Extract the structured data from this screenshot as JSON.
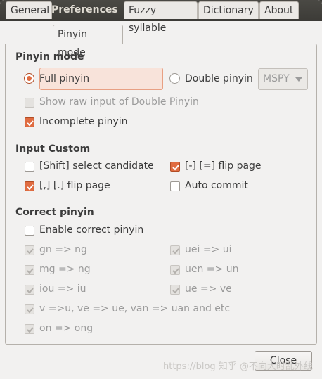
{
  "window": {
    "title": "Preferences"
  },
  "tabs": [
    {
      "label": "General"
    },
    {
      "label": "Pinyin mode"
    },
    {
      "label": "Fuzzy syllable"
    },
    {
      "label": "Dictionary"
    },
    {
      "label": "About"
    }
  ],
  "active_tab": "Pinyin mode",
  "pinyin_mode": {
    "heading": "Pinyin mode",
    "full_pinyin": {
      "label": "Full pinyin",
      "selected": true
    },
    "double_pinyin": {
      "label": "Double pinyin",
      "selected": false
    },
    "scheme": {
      "value": "MSPY"
    },
    "show_raw": {
      "label": "Show raw input of Double Pinyin",
      "checked": false,
      "enabled": false
    },
    "incomplete": {
      "label": "Incomplete pinyin",
      "checked": true
    }
  },
  "input_custom": {
    "heading": "Input Custom",
    "shift_select": {
      "label": "[Shift] select candidate",
      "checked": false
    },
    "minus_equal_flip": {
      "label": "[-] [=] flip page",
      "checked": true
    },
    "comma_period_flip": {
      "label": "[,] [.] flip page",
      "checked": true
    },
    "auto_commit": {
      "label": "Auto commit",
      "checked": false
    }
  },
  "correct_pinyin": {
    "heading": "Correct pinyin",
    "enable": {
      "label": "Enable correct pinyin",
      "checked": false
    },
    "rules": {
      "gn": {
        "label": "gn => ng",
        "checked": true
      },
      "uei": {
        "label": "uei => ui",
        "checked": true
      },
      "mg": {
        "label": "mg => ng",
        "checked": true
      },
      "uen": {
        "label": "uen => un",
        "checked": true
      },
      "iou": {
        "label": "iou => iu",
        "checked": true
      },
      "ue": {
        "label": "ue => ve",
        "checked": true
      },
      "v": {
        "label": "v =>u, ve => ue, van => uan and etc",
        "checked": true
      },
      "on": {
        "label": "on => ong",
        "checked": true
      }
    }
  },
  "close_button": {
    "label": "Close"
  },
  "watermark": {
    "text": "https://blog 知乎 @不向大时乱外线"
  },
  "colors": {
    "accent": "#e06c41",
    "titlebar": "#3c3b37",
    "background": "#f2f1f0"
  }
}
